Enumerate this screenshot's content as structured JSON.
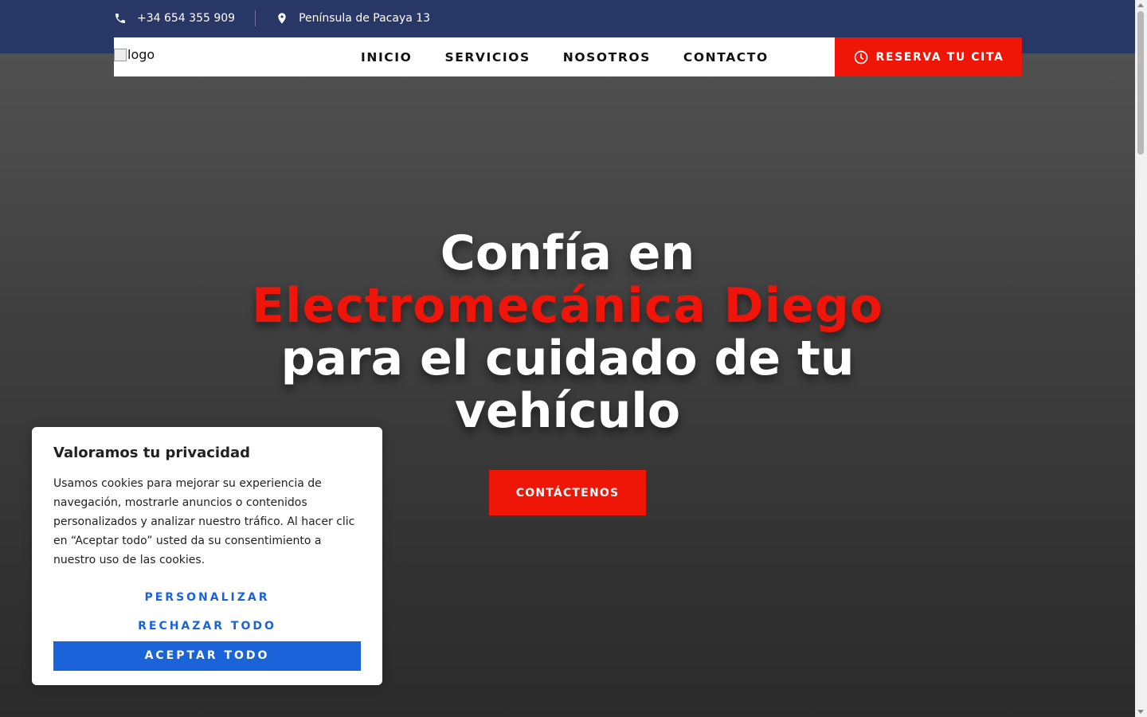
{
  "topbar": {
    "phone": "+34 654 355 909",
    "address": "Península de Pacaya 13",
    "phone_icon": "phone-icon",
    "address_icon": "map-pin-icon"
  },
  "navbar": {
    "logo_alt": "logo",
    "items": [
      {
        "label": "INICIO"
      },
      {
        "label": "SERVICIOS"
      },
      {
        "label": "NOSOTROS"
      },
      {
        "label": "CONTACTO"
      }
    ],
    "cta_label": "RESERVA TU CITA",
    "cta_icon": "clock-icon"
  },
  "hero": {
    "line1": "Confía en",
    "accent": "Electromecánica Diego",
    "line3": "para el cuidado de tu",
    "line4": "vehículo",
    "button_label": "CONTÁCTENOS"
  },
  "cookie_banner": {
    "title": "Valoramos tu privacidad",
    "body": "Usamos cookies para mejorar su experiencia de navegación, mostrarle anuncios o contenidos personalizados y analizar nuestro tráfico. Al hacer clic en “Aceptar todo” usted da su consentimiento a nuestro uso de las cookies.",
    "customize_label": "PERSONALIZAR",
    "reject_label": "RECHAZAR TODO",
    "accept_label": "ACEPTAR TODO"
  },
  "colors": {
    "topbar_bg": "#283765",
    "accent_red": "#ef1507",
    "cookie_blue": "#1a63d8"
  }
}
